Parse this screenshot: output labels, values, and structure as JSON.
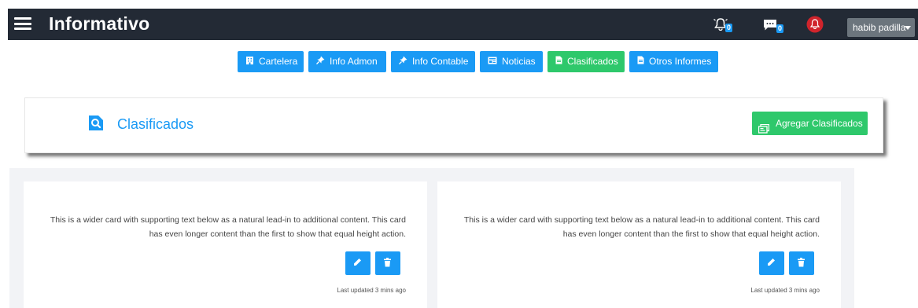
{
  "app": {
    "title": "Informativo"
  },
  "navbar": {
    "notifications_count": "0",
    "messages_count": "0",
    "user_name": "habib padilla"
  },
  "tabs": [
    {
      "label": "Cartelera",
      "icon": "building-icon",
      "active": false
    },
    {
      "label": "Info Admon",
      "icon": "pin-icon",
      "active": false
    },
    {
      "label": "Info Contable",
      "icon": "pin-icon",
      "active": false
    },
    {
      "label": "Noticias",
      "icon": "newspaper-icon",
      "active": false
    },
    {
      "label": "Clasificados",
      "icon": "file-icon",
      "active": true
    },
    {
      "label": "Otros Informes",
      "icon": "file-icon",
      "active": false
    }
  ],
  "page": {
    "title": "Clasificados",
    "add_button_label": "Agregar Clasificados"
  },
  "cards": [
    {
      "text": "This is a wider card with supporting text below as a natural lead-in to additional content. This card has even longer content than the first to show that equal height action.",
      "updated": "Last updated 3 mins ago"
    },
    {
      "text": "This is a wider card with supporting text below as a natural lead-in to additional content. This card has even longer content than the first to show that equal height action.",
      "updated": "Last updated 3 mins ago"
    }
  ],
  "colors": {
    "navbar": "#232a35",
    "primary": "#1a9af5",
    "success": "#2ec86b",
    "secondary": "#6c757d"
  }
}
